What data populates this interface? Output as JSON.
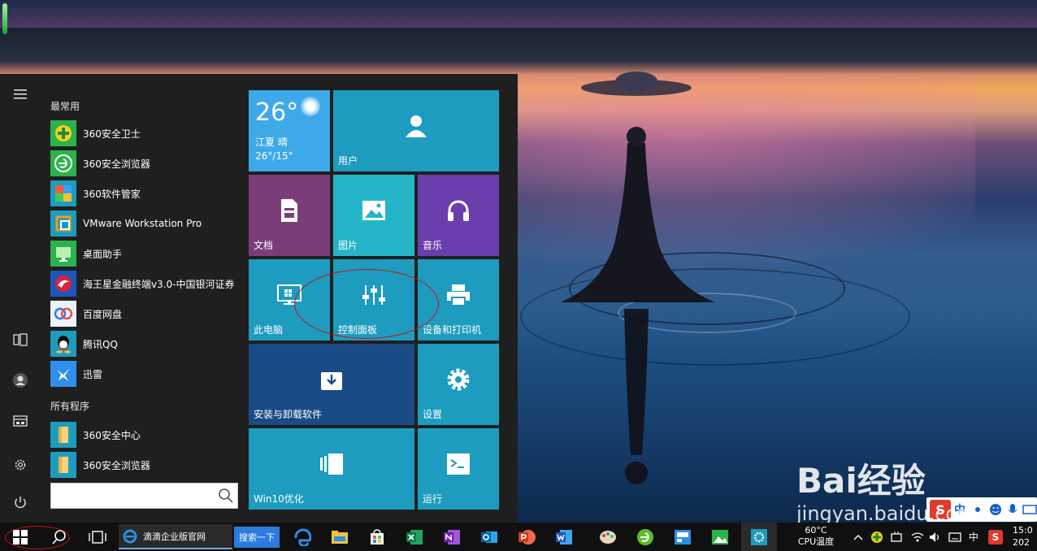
{
  "start_menu": {
    "section_most_used": "最常用",
    "section_all_programs": "所有程序",
    "most_used": [
      {
        "label": "360安全卫士",
        "icon": "360-safe-guard-icon"
      },
      {
        "label": "360安全浏览器",
        "icon": "360-browser-icon"
      },
      {
        "label": "360软件管家",
        "icon": "360-software-manager-icon"
      },
      {
        "label": "VMware Workstation Pro",
        "icon": "vmware-icon"
      },
      {
        "label": "桌面助手",
        "icon": "desktop-assistant-icon"
      },
      {
        "label": "海王星金融终端v3.0-中国银河证券",
        "icon": "neptune-finance-icon"
      },
      {
        "label": "百度网盘",
        "icon": "baidu-netdisk-icon"
      },
      {
        "label": "腾讯QQ",
        "icon": "qq-icon"
      },
      {
        "label": "迅雷",
        "icon": "xunlei-icon"
      }
    ],
    "all_programs": [
      {
        "label": "360安全中心",
        "icon": "folder-icon"
      },
      {
        "label": "360安全浏览器",
        "icon": "folder-icon"
      }
    ],
    "search_placeholder": ""
  },
  "tiles": {
    "weather": {
      "temp": "26°",
      "city": "江夏 晴",
      "range": "26°/15°"
    },
    "user": "用户",
    "documents": "文档",
    "pictures": "图片",
    "music": "音乐",
    "this_pc": "此电脑",
    "control_panel": "控制面板",
    "devices_printers": "设备和打印机",
    "install_uninstall": "安装与卸载软件",
    "settings": "设置",
    "win10_optimize": "Win10优化",
    "run": "运行"
  },
  "taskbar": {
    "ie_window_title": "滴滴企业版官网",
    "search_button": "搜索一下",
    "cpu_temp": "60°C",
    "cpu_label": "CPU温度",
    "ime_mode": "中",
    "clock_time": "15:0",
    "clock_date": "202"
  },
  "ime_bar": {
    "text": "中"
  },
  "watermark": {
    "brand": "Bai经验",
    "url": "jingyan.baidu.com"
  },
  "colors": {
    "tile_teal": "#1d9cbf",
    "tile_purple_docs": "#7a3d7a",
    "tile_purple_music": "#6a3fad",
    "tile_navy": "#1b4b86",
    "tile_weather": "#3ea9e8",
    "annotation_red": "#c41313"
  }
}
